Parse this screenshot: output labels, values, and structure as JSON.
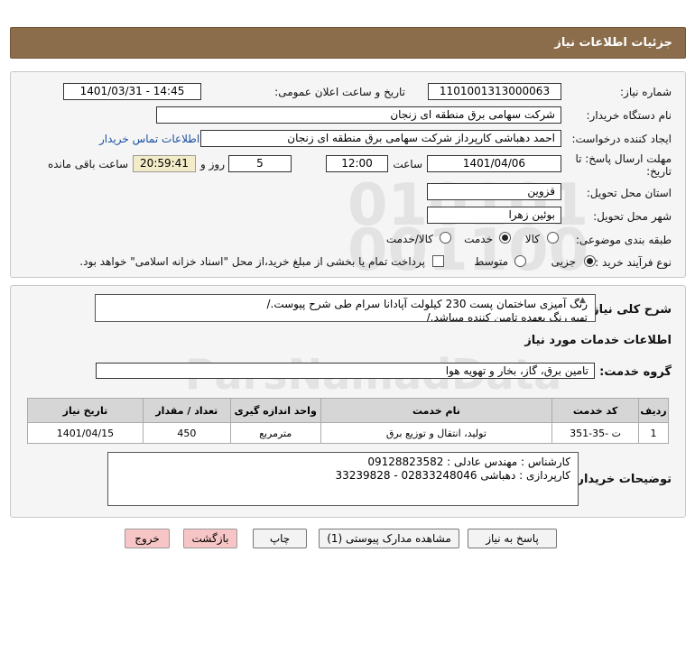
{
  "header": {
    "title": "جزئیات اطلاعات نیاز"
  },
  "form": {
    "need_number_label": "شماره نیاز:",
    "need_number": "1101001313000063",
    "announce_label": "تاریخ و ساعت اعلان عمومی:",
    "announce_value": "1401/03/31 - 14:45",
    "buyer_label": "نام دستگاه خریدار:",
    "buyer_value": "شرکت سهامی برق منطقه ای زنجان",
    "requester_label": "ایجاد کننده درخواست:",
    "requester_value": "احمد دهباشی کارپرداز شرکت سهامی برق منطقه ای زنجان",
    "contact_link": "اطلاعات تماس خریدار",
    "deadline_label_1": "مهلت ارسال پاسخ: تا",
    "deadline_label_2": "تاریخ:",
    "deadline_date": "1401/04/06",
    "time_label": "ساعت",
    "deadline_time": "12:00",
    "days_value": "5",
    "days_label": "روز و",
    "remaining_time": "20:59:41",
    "remaining_label": "ساعت باقی مانده",
    "province_label": "استان محل تحویل:",
    "province_value": "قزوین",
    "city_label": "شهر محل تحویل:",
    "city_value": "بوئین زهرا",
    "category_label": "طبقه بندی موضوعی:",
    "category_options": [
      "کالا",
      "خدمت",
      "کالا/خدمت"
    ],
    "category_selected": "خدمت",
    "process_label": "نوع فرآیند خرید :",
    "process_options": [
      "جزیی",
      "متوسط"
    ],
    "process_selected": "جزیی",
    "payment_note": "پرداخت تمام یا بخشی از مبلغ خرید،از محل \"اسناد خزانه اسلامی\" خواهد بود."
  },
  "details": {
    "description_label": "شرح کلی نیاز:",
    "description_line1": "رنگ آمیزی ساختمان پست 230 کیلولت آپادانا سرام طی شرح پیوست./",
    "description_line2": "تهیه رنگ بعهده تامین کننده میباشد./",
    "services_heading": "اطلاعات خدمات مورد نیاز",
    "service_group_label": "گروه خدمت:",
    "service_group_value": "تامین برق، گاز، بخار و تهویه هوا",
    "table": {
      "headers": [
        "ردیف",
        "کد خدمت",
        "نام خدمت",
        "واحد اندازه گیری",
        "تعداد / مقدار",
        "تاریخ نیاز"
      ],
      "rows": [
        [
          "1",
          "ت -35-351",
          "تولید، انتقال و توزیع برق",
          "مترمربع",
          "450",
          "1401/04/15"
        ]
      ]
    },
    "buyer_notes_label": "توضیحات خریدار:",
    "buyer_notes_line1": "کارشناس : مهندس عادلی : 09128823582",
    "buyer_notes_line2": "کارپردازی : دهباشی 02833248046 - 33239828"
  },
  "buttons": {
    "reply": "پاسخ به نیاز",
    "view_docs": "مشاهده مدارک پیوستی (1)",
    "print": "چاپ",
    "back": "بازگشت",
    "exit": "خروج"
  },
  "colors": {
    "header_bg": "#8b6d4c",
    "remaining_bg": "#f2ecc8",
    "exit_bg": "#f7c5c5"
  }
}
